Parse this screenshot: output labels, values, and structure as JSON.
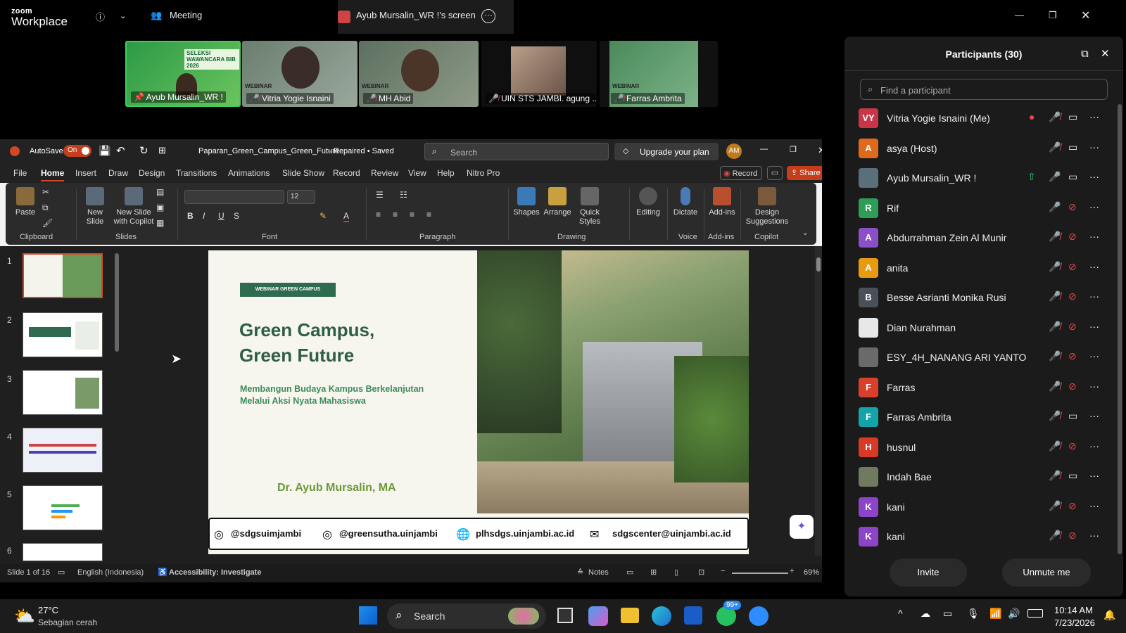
{
  "zoom": {
    "logo_line1": "zoom",
    "logo_line2": "Workplace",
    "meeting_label": "Meeting",
    "screen_tab_label": "Ayub Mursalin_WR !'s screen"
  },
  "videos": [
    {
      "name": "Ayub Mursalin_WR !",
      "tile_text": "SELEKSI WAWANCARA BIB 2026"
    },
    {
      "name": "Vitria Yogie Isnaini",
      "tile_text": "WEBINAR"
    },
    {
      "name": "MH Abid",
      "tile_text": "WEBINAR"
    },
    {
      "name": "UIN STS JAMBI. agung ...",
      "tile_text": ""
    },
    {
      "name": "Farras Ambrita",
      "tile_text": "WEBINAR"
    }
  ],
  "ppt": {
    "autosave_label": "AutoSave",
    "autosave_state": "On",
    "filename": "Paparan_Green_Campus_Green_Future",
    "file_status": "Repaired • Saved",
    "search_placeholder": "Search",
    "upgrade_label": "Upgrade your plan",
    "user_initials": "AM",
    "tabs": [
      "File",
      "Home",
      "Insert",
      "Draw",
      "Design",
      "Transitions",
      "Animations",
      "Slide Show",
      "Record",
      "Review",
      "View",
      "Help",
      "Nitro Pro"
    ],
    "record_label": "Record",
    "share_label": "Share",
    "ribbon": {
      "paste": "Paste",
      "new_slide": "New Slide",
      "new_slide_copilot": "New Slide with Copilot",
      "font_size": "12",
      "shapes": "Shapes",
      "arrange": "Arrange",
      "quick_styles": "Quick Styles",
      "editing": "Editing",
      "dictate": "Dictate",
      "addins": "Add-ins",
      "design_suggestions": "Design Suggestions",
      "groups": [
        "Clipboard",
        "Slides",
        "Font",
        "Paragraph",
        "Drawing",
        "Voice",
        "Add-ins",
        "Copilot"
      ]
    },
    "thumbnail_numbers": [
      "1",
      "2",
      "3",
      "4",
      "5",
      "6"
    ],
    "slide": {
      "badge": "WEBINAR GREEN CAMPUS",
      "title_line1": "Green Campus,",
      "title_line2": "Green Future",
      "subtitle_line1": "Membangun Budaya Kampus Berkelanjutan",
      "subtitle_line2": "Melalui Aksi Nyata Mahasiswa",
      "presenter": "Dr. Ayub Mursalin, MA",
      "footer": [
        "@sdgsuimjambi",
        "@greensutha.uinjambi",
        "plhsdgs.uinjambi.ac.id",
        "sdgscenter@uinjambi.ac.id"
      ]
    },
    "status": {
      "slide_of": "Slide 1 of 16",
      "language": "English (Indonesia)",
      "accessibility": "Accessibility: Investigate",
      "notes": "Notes",
      "zoom": "69%"
    }
  },
  "participants": {
    "title": "Participants (30)",
    "search_placeholder": "Find a participant",
    "list": [
      {
        "initials": "VY",
        "name": "Vitria Yogie Isnaini (Me)",
        "color": "#c9364a",
        "mic": "off",
        "video": "on",
        "rec": true
      },
      {
        "initials": "A",
        "name": "asya (Host)",
        "color": "#e06a1b",
        "mic": "off",
        "video": "on"
      },
      {
        "initials": "",
        "name": "Ayub Mursalin_WR !",
        "color": "#5a6f7a",
        "mic": "on",
        "video": "on",
        "share": true
      },
      {
        "initials": "R",
        "name": "Rif",
        "color": "#2e9d58",
        "mic": "on",
        "video": "off"
      },
      {
        "initials": "A",
        "name": "Abdurrahman Zein Al Munir",
        "color": "#8b4fc8",
        "mic": "off",
        "video": "off"
      },
      {
        "initials": "A",
        "name": "anita",
        "color": "#e89a10",
        "mic": "off",
        "video": "off"
      },
      {
        "initials": "B",
        "name": "Besse Asrianti Monika Rusi",
        "color": "#4a5058",
        "mic": "off",
        "video": "off"
      },
      {
        "initials": "",
        "name": "Dian Nurahman",
        "color": "#e8e8e8",
        "mic": "off",
        "video": "off"
      },
      {
        "initials": "",
        "name": "ESY_4H_NANANG ARI YANTO",
        "color": "#6a6a6a",
        "mic": "off",
        "video": "off"
      },
      {
        "initials": "F",
        "name": "Farras",
        "color": "#d9402b",
        "mic": "off",
        "video": "off"
      },
      {
        "initials": "F",
        "name": "Farras Ambrita",
        "color": "#14a3a8",
        "mic": "off",
        "video": "on"
      },
      {
        "initials": "H",
        "name": "husnul",
        "color": "#d93a26",
        "mic": "off",
        "video": "off"
      },
      {
        "initials": "",
        "name": "Indah Bae",
        "color": "#6f7a60",
        "mic": "off",
        "video": "on"
      },
      {
        "initials": "K",
        "name": "kani",
        "color": "#8e44c9",
        "mic": "off",
        "video": "off"
      },
      {
        "initials": "K",
        "name": "kani",
        "color": "#8e44c9",
        "mic": "off",
        "video": "off"
      }
    ],
    "invite_label": "Invite",
    "unmute_label": "Unmute me"
  },
  "taskbar": {
    "temp": "27°C",
    "weather": "Sebagian cerah",
    "search_label": "Search",
    "badge": "99+",
    "time": "10:14 AM",
    "date": "7/23/2026"
  }
}
